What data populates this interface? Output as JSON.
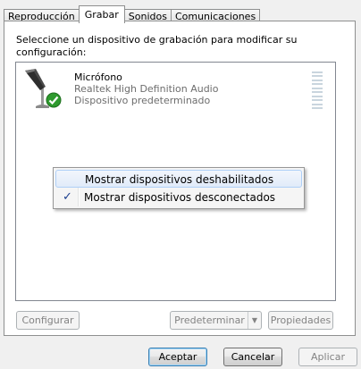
{
  "tabs": [
    {
      "label": "Reproducción",
      "active": false
    },
    {
      "label": "Grabar",
      "active": true
    },
    {
      "label": "Sonidos",
      "active": false
    },
    {
      "label": "Comunicaciones",
      "active": false
    }
  ],
  "instruction": "Seleccione un dispositivo de grabación para modificar su configuración:",
  "device": {
    "name": "Micrófono",
    "driver": "Realtek High Definition Audio",
    "status": "Dispositivo predeterminado",
    "icon": "microphone-icon",
    "badge_icon": "default-check-icon"
  },
  "context_menu": {
    "items": [
      {
        "label": "Mostrar dispositivos deshabilitados",
        "checked": false,
        "highlighted": true
      },
      {
        "label": "Mostrar dispositivos desconectados",
        "checked": true,
        "highlighted": false
      }
    ],
    "check_glyph": "✓"
  },
  "panel_buttons": {
    "configure": "Configurar",
    "set_default": "Predeterminar",
    "properties": "Propiedades",
    "dropdown_glyph": "▼"
  },
  "dialog_buttons": {
    "ok": "Aceptar",
    "cancel": "Cancelar",
    "apply": "Aplicar"
  },
  "colors": {
    "menu_highlight_border": "#aecff7",
    "default_button_border": "#3c7fb1",
    "check_green": "#2e9a2e"
  }
}
